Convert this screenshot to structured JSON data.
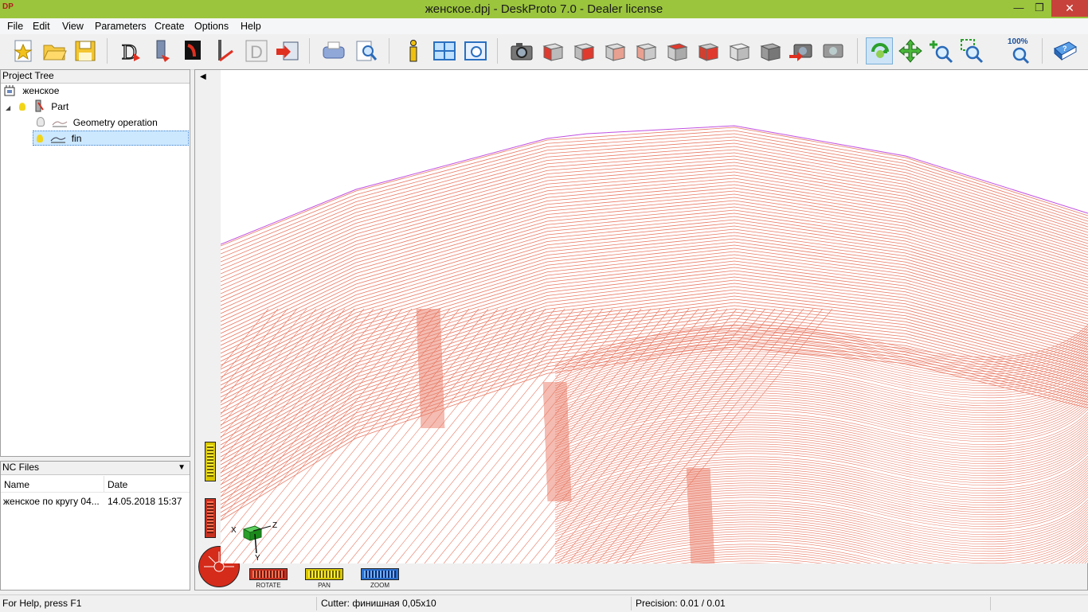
{
  "window": {
    "title": "женское.dpj - DeskProto 7.0 - Dealer license",
    "app_icon": "DP"
  },
  "menu": [
    "File",
    "Edit",
    "View",
    "Parameters",
    "Create",
    "Options",
    "Help"
  ],
  "toolbar_icons": [
    "new-project-icon",
    "open-icon",
    "save-icon",
    "create-nc-icon",
    "part-parameters-icon",
    "geometry-parameters-icon",
    "operation-parameters-icon",
    "design-icon",
    "save-nc-icon",
    "print-icon",
    "print-preview-icon",
    "info-icon",
    "window-layout-icon",
    "view-options-icon",
    "camera-icon",
    "view-front-icon",
    "view-back-icon",
    "view-left-icon",
    "view-right-icon",
    "view-top-icon",
    "view-bottom-icon",
    "view-iso-icon",
    "view-shaded-icon",
    "view-previous-icon",
    "view-refresh-icon",
    "rotate-mode-icon",
    "pan-mode-icon",
    "zoom-mode-icon",
    "zoom-window-icon",
    "zoom-100-icon",
    "help-book-icon"
  ],
  "zoom_label": "100%",
  "project_tree": {
    "header": "Project Tree",
    "root": "женское",
    "part": "Part",
    "operations": [
      "Geometry operation",
      "fin"
    ]
  },
  "nc_files": {
    "header": "NC Files",
    "columns": [
      "Name",
      "Date"
    ],
    "rows": [
      {
        "name": "женское по кругу 04...",
        "date": "14.05.2018 15:37"
      }
    ]
  },
  "viewport": {
    "axes": {
      "x": "X",
      "y": "Y",
      "z": "Z"
    },
    "sliders": {
      "rotate": "ROTATE",
      "pan": "PAN",
      "zoom": "ZOOM"
    }
  },
  "status": {
    "help": "For Help, press F1",
    "cutter": "Cutter: финишная 0,05x10",
    "precision": "Precision: 0.01 / 0.01"
  },
  "colors": {
    "title_bar": "#9bc53d",
    "toolpath": "#e87a65",
    "highlight": "#cce8ff"
  }
}
